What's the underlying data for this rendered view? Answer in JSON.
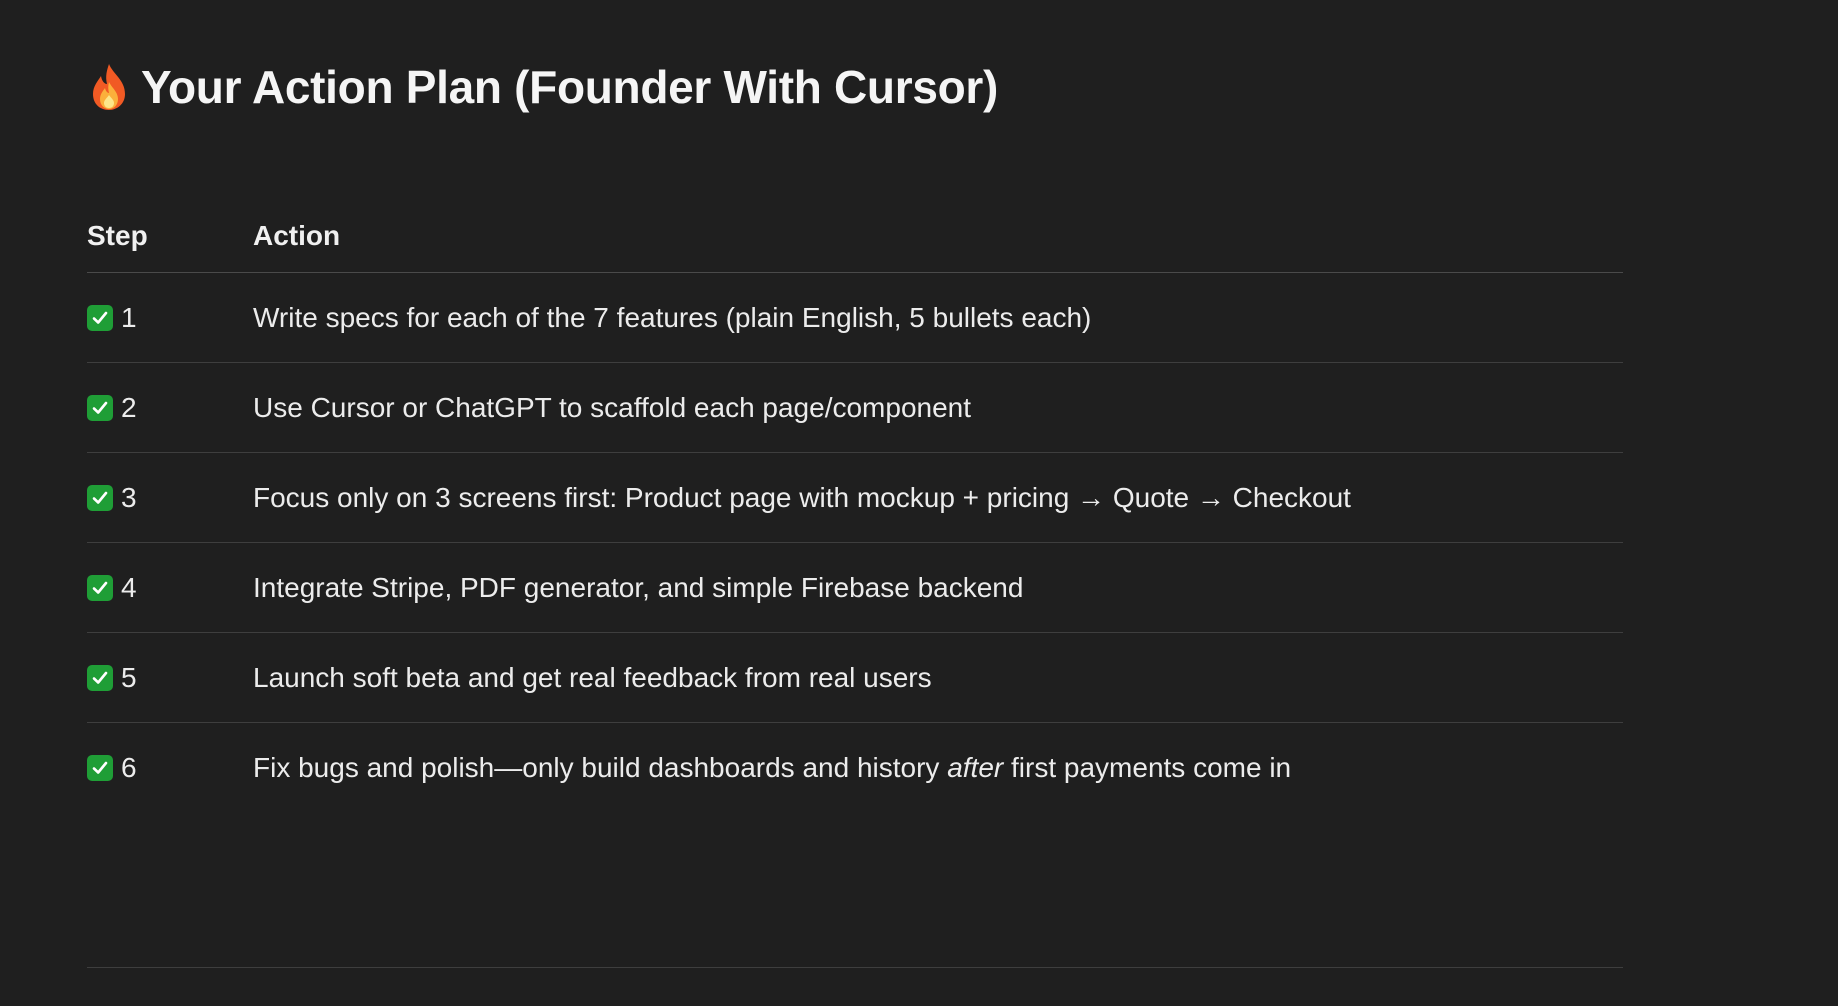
{
  "heading": {
    "icon": "fire-icon",
    "text": "Your Action Plan (Founder With Cursor)"
  },
  "table": {
    "headers": {
      "step": "Step",
      "action": "Action"
    },
    "rows": [
      {
        "icon": "check-mark-button-icon",
        "step": "1",
        "action": "Write specs for each of the 7 features (plain English, 5 bullets each)"
      },
      {
        "icon": "check-mark-button-icon",
        "step": "2",
        "action": "Use Cursor or ChatGPT to scaffold each page/component"
      },
      {
        "icon": "check-mark-button-icon",
        "step": "3",
        "action": "Focus only on 3 screens first: Product page with mockup + pricing → Quote → Checkout"
      },
      {
        "icon": "check-mark-button-icon",
        "step": "4",
        "action": "Integrate Stripe, PDF generator, and simple Firebase backend"
      },
      {
        "icon": "check-mark-button-icon",
        "step": "5",
        "action": "Launch soft beta and get real feedback from real users"
      },
      {
        "icon": "check-mark-button-icon",
        "step": "6",
        "action_before": "Fix bugs and polish—only build dashboards and history ",
        "action_emphasis": "after",
        "action_after": " first payments come in"
      }
    ]
  },
  "colors": {
    "background": "#1f1f1f",
    "text": "#ececec",
    "divider": "#3e3e3e",
    "check_green": "#1f9e36"
  }
}
